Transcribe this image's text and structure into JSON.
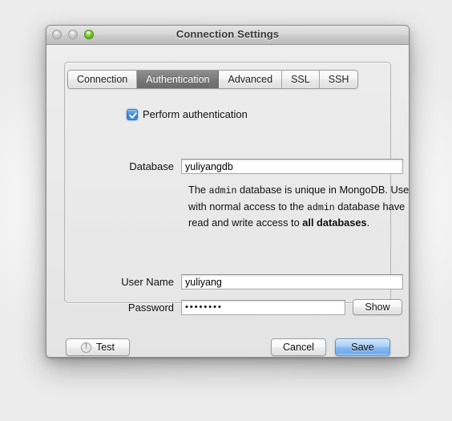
{
  "window": {
    "title": "Connection Settings",
    "traffic_lights": [
      {
        "name": "close-button",
        "state": "disabled"
      },
      {
        "name": "minimize-button",
        "state": "disabled"
      },
      {
        "name": "zoom-button",
        "state": "active",
        "color": "#75c62e"
      }
    ]
  },
  "tabs": [
    {
      "label": "Connection",
      "active": false
    },
    {
      "label": "Authentication",
      "active": true
    },
    {
      "label": "Advanced",
      "active": false
    },
    {
      "label": "SSL",
      "active": false
    },
    {
      "label": "SSH",
      "active": false
    }
  ],
  "form": {
    "perform_auth": {
      "label": "Perform authentication",
      "checked": true
    },
    "database": {
      "label": "Database",
      "value": "yuliyangdb",
      "placeholder": ""
    },
    "description": {
      "part1": "The ",
      "mono1": "admin",
      "part2": " database is unique in MongoDB. Users with normal access to the ",
      "mono2": "admin",
      "part3": " database have read and write access to ",
      "bold1": "all databases",
      "part4": "."
    },
    "username": {
      "label": "User Name",
      "value": "yuliyang",
      "placeholder": ""
    },
    "password": {
      "label": "Password",
      "value": "••••••••",
      "placeholder": "",
      "show_label": "Show"
    }
  },
  "footer": {
    "test_label": "Test",
    "cancel_label": "Cancel",
    "save_label": "Save"
  },
  "colors": {
    "accent_blue": "#3f8ddd",
    "default_button_blue": "#8abdf2",
    "active_tab_grey": "#767676",
    "window_bg": "#e8e8e8"
  }
}
